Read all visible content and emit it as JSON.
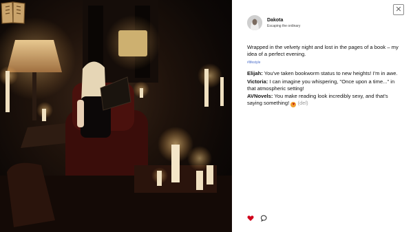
{
  "post": {
    "author": {
      "name": "Dakota",
      "status": "Escaping the ordinary"
    },
    "text": "Wrapped in the velvety night and lost in the pages of a book – my idea of a perfect evening.",
    "hashtag": "#lifestyle",
    "comments": [
      {
        "author": "Elijah:",
        "text": "You've taken bookworm status to new heights! I'm in awe."
      },
      {
        "author": "Victoria:",
        "text": "I can imagine you whispering, \"Once upon a time...\" in that atmospheric setting!"
      },
      {
        "author": "AVNovels:",
        "text": "You make reading look incredibly sexy, and that's saying something!",
        "emoji": "heart-eyes",
        "delete_label": "(del)"
      }
    ]
  },
  "ui": {
    "close_label": "✕",
    "accent_like": "#d0021b",
    "hashtag_color": "#4a6cc9"
  }
}
